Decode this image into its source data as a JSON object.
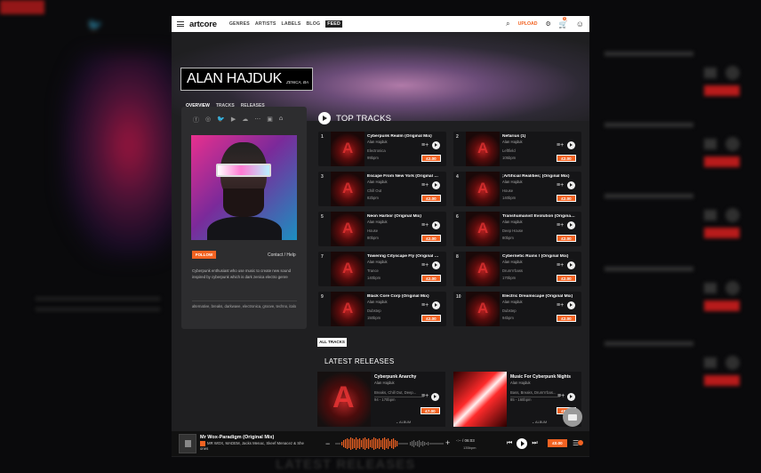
{
  "header": {
    "logo": "artcore",
    "nav": [
      "GENRES",
      "ARTISTS",
      "LABELS",
      "BLOG",
      "FEED"
    ],
    "upload": "UPLOAD",
    "cart_count": "0",
    "cart_total": "£0.00"
  },
  "artist": {
    "name": "ALAN HAJDUK",
    "location": "ZENICA, BA",
    "tabs": [
      "OVERVIEW",
      "TRACKS",
      "RELEASES"
    ],
    "follow": "FOLLOW",
    "contact": "Contact / Help",
    "bio": "Cyberpunk enthusiast who use music to create new sound inspired by cyberpunk which is dark zenica electro genre",
    "tags": "alternative, breaks, darkwave, electronica, groove, techno, italo"
  },
  "top_tracks": {
    "title": "TOP TRACKS",
    "all_label": "ALL TRACKS",
    "items": [
      {
        "num": "1",
        "title": "Cyberpunk Realm (Original Mix)",
        "artist": "Alan Hajduk",
        "genre": "Electronica",
        "bpm": "99bpm",
        "price": "£2.00"
      },
      {
        "num": "2",
        "title": "Nefarius (1)",
        "artist": "Alan Hajduk",
        "genre": "Leftfield",
        "bpm": "105bpm",
        "price": "£2.00"
      },
      {
        "num": "3",
        "title": "Escape From New York (Original Mix)",
        "artist": "Alan Hajduk",
        "genre": "Chill Out",
        "bpm": "82bpm",
        "price": "£2.00"
      },
      {
        "num": "4",
        "title": ";Artificial Realities; (Original Mix)",
        "artist": "Alan Hajduk",
        "genre": "House",
        "bpm": "140bpm",
        "price": "£2.00"
      },
      {
        "num": "5",
        "title": "Neon Harbor (Original Mix)",
        "artist": "Alan Hajduk",
        "genre": "House",
        "bpm": "80bpm",
        "price": "£2.00"
      },
      {
        "num": "6",
        "title": "Transhumanist Evolution (Original Mix)",
        "artist": "Alan Hajduk",
        "genre": "Deep House",
        "bpm": "80bpm",
        "price": "£2.00"
      },
      {
        "num": "7",
        "title": "Towering Cityscape Fly (Original Mix)",
        "artist": "Alan Hajduk",
        "genre": "Trance",
        "bpm": "140bpm",
        "price": "£2.00"
      },
      {
        "num": "8",
        "title": "Cybernetic Ruins ! (Original Mix)",
        "artist": "Alan Hajduk",
        "genre": "Drum'n'bass",
        "bpm": "170bpm",
        "price": "£2.00"
      },
      {
        "num": "9",
        "title": "Black Core Corp (Original Mix)",
        "artist": "Alan Hajduk",
        "genre": "Dubstep",
        "bpm": "150bpm",
        "price": "£2.00"
      },
      {
        "num": "10",
        "title": "Electric Dreamscape (Original Mix)",
        "artist": "Alan Hajduk",
        "genre": "Dubstep",
        "bpm": "94bpm",
        "price": "£2.00"
      }
    ]
  },
  "latest_releases": {
    "title": "LATEST RELEASES",
    "items": [
      {
        "title": "Cyberpunk Anarchy",
        "artist": "Alan Hajduk",
        "genres": "Breaks, Chill Out, Deep...",
        "bpm": "94 - 170bpm",
        "price": "£7.00",
        "type": "ALBUM"
      },
      {
        "title": "Music For Cyberpunk Nights",
        "artist": "Alan Hajduk",
        "genres": "Bass, Breaks, Drum'n'bas...",
        "bpm": "85 - 160bpm",
        "price": "£6.00",
        "type": "ALBUM"
      }
    ]
  },
  "player": {
    "title": "Mr Wox-Paradigm (Original Mix)",
    "artists": "MR WOX, MADEM, Jacks Menac, Skeef Menacez & She ones",
    "time": "-:-- / 06:03",
    "bpm": "135bpm",
    "price": "£0.00"
  },
  "background": {
    "bottom_text": "LATEST RELEASES",
    "follow": "FOLLOW"
  },
  "colors": {
    "accent": "#f26322",
    "surface": "#1f1f21",
    "card": "#2d2d2f"
  }
}
